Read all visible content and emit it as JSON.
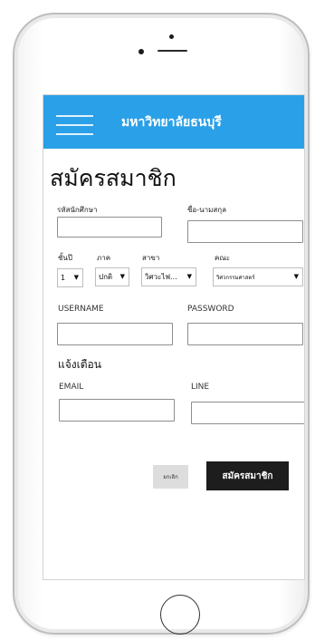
{
  "app": {
    "title": "มหาวิทยาลัยธนบุรี"
  },
  "form": {
    "title": "สมัครสมาชิก",
    "student_id": {
      "label": "รหัสนักศึกษา",
      "value": ""
    },
    "full_name": {
      "label": "ชื่อ-นามสกุล",
      "value": ""
    },
    "year": {
      "label": "ชั้นปี",
      "value": "1"
    },
    "term": {
      "label": "ภาค",
      "value": "ปกติ"
    },
    "major": {
      "label": "สาขา",
      "value": "วิศวะไฟ..."
    },
    "faculty": {
      "label": "คณะ",
      "value": "วิศวกรรมศาสตร์"
    },
    "username": {
      "label": "USERNAME",
      "value": ""
    },
    "password": {
      "label": "PASSWORD",
      "value": ""
    },
    "notify_heading": "แจ้งเตือน",
    "email": {
      "label": "EMAIL",
      "value": ""
    },
    "line": {
      "label": "LINE",
      "value": ""
    },
    "cancel_label": "ยกเลิก",
    "submit_label": "สมัครสมาชิก"
  },
  "colors": {
    "appbar": "#2aa0e8",
    "submit_button": "#1d1d1d",
    "cancel_button": "#dddddd"
  },
  "icons": {
    "menu": "hamburger-menu-icon",
    "dropdown": "caret-down-icon"
  }
}
